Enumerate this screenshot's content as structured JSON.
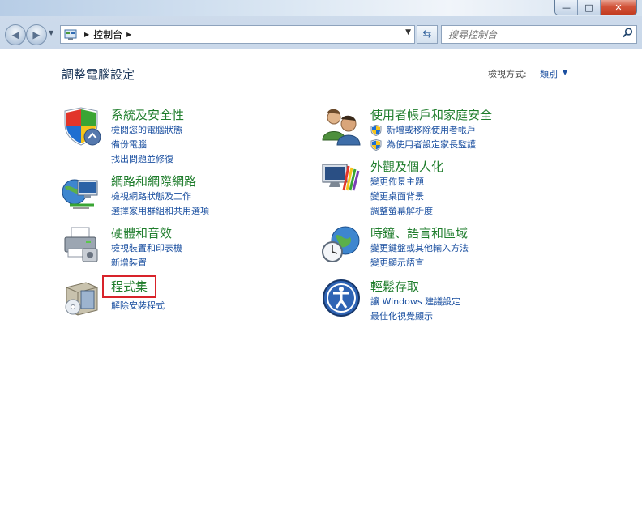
{
  "window": {
    "minimize_glyph": "—",
    "maximize_glyph": "□",
    "close_glyph": "✕"
  },
  "nav": {
    "back_glyph": "◀",
    "forward_glyph": "▶",
    "address_segments": [
      "控制台"
    ],
    "search_placeholder": "搜尋控制台"
  },
  "main": {
    "title": "調整電腦設定",
    "view_by_label": "檢視方式:",
    "view_by_value": "類別"
  },
  "categories": [
    {
      "id": "system",
      "title": "系統及安全性",
      "icon": "shield-security-icon",
      "links": [
        "檢閱您的電腦狀態",
        "備份電腦",
        "找出問題並修復"
      ]
    },
    {
      "id": "network",
      "title": "網路和網際網路",
      "icon": "network-globe-icon",
      "links": [
        "檢視網路狀態及工作",
        "選擇家用群組和共用選項"
      ]
    },
    {
      "id": "hardware",
      "title": "硬體和音效",
      "icon": "printer-icon",
      "links": [
        "檢視裝置和印表機",
        "新增裝置"
      ]
    },
    {
      "id": "programs",
      "title": "程式集",
      "icon": "programs-box-icon",
      "links": [
        "解除安裝程式"
      ]
    },
    {
      "id": "users",
      "title": "使用者帳戶和家庭安全",
      "icon": "users-icon",
      "links": [
        "新增或移除使用者帳戶",
        "為使用者設定家長監護"
      ]
    },
    {
      "id": "appearance",
      "title": "外觀及個人化",
      "icon": "monitor-palette-icon",
      "links": [
        "變更佈景主題",
        "變更桌面背景",
        "調整螢幕解析度"
      ]
    },
    {
      "id": "clock",
      "title": "時鐘、語言和區域",
      "icon": "clock-globe-icon",
      "links": [
        "變更鍵盤或其他輸入方法",
        "變更顯示語言"
      ]
    },
    {
      "id": "access",
      "title": "輕鬆存取",
      "icon": "ease-of-access-icon",
      "links": [
        "讓 Windows 建議設定",
        "最佳化視覺顯示"
      ]
    }
  ],
  "colors": {
    "category_title": "#1f7d2c",
    "link": "#1a4fa0",
    "highlight_border": "#d8232a"
  }
}
